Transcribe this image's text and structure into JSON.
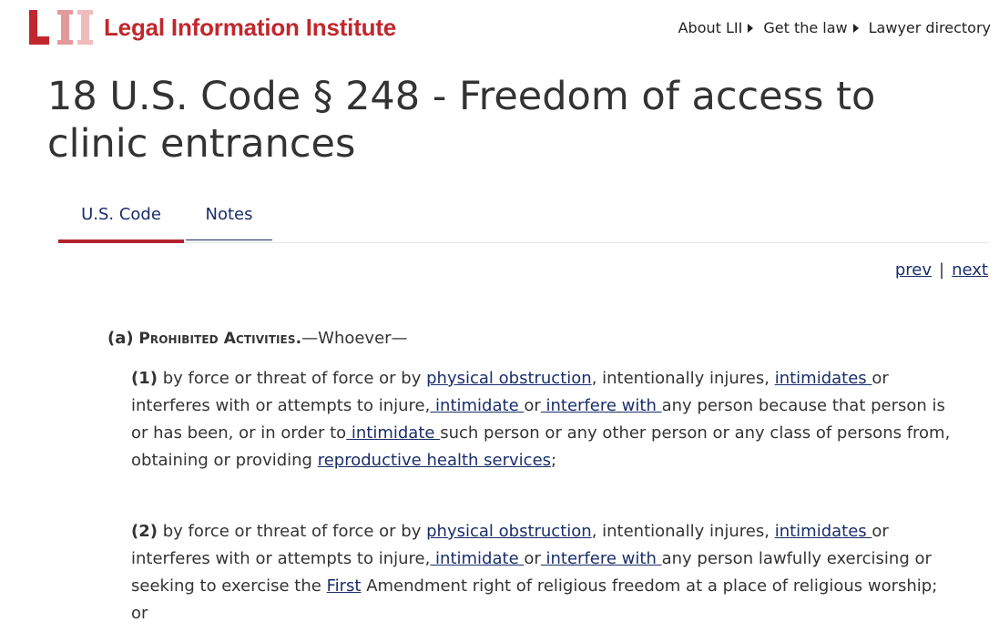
{
  "header": {
    "logo_letters": "LII",
    "logo_text": "Legal Information Institute",
    "nav": [
      {
        "label": "About LII"
      },
      {
        "label": "Get the law"
      },
      {
        "label": "Lawyer directory"
      }
    ],
    "colors": {
      "brand_red": "#c1272d",
      "link_navy": "#1a2d6b",
      "tab_active_underline": "#b0232a"
    }
  },
  "page": {
    "title": "18 U.S. Code § 248 - Freedom of access to clinic entrances"
  },
  "tabs": [
    {
      "label": "U.S. Code",
      "active": true
    },
    {
      "label": "Notes",
      "active": false
    }
  ],
  "pager": {
    "prev": "prev",
    "separator": "|",
    "next": "next"
  },
  "statute": {
    "subsection_a": {
      "enum": "(a)",
      "heading": "Prohibited Activities.",
      "lead": "—Whoever—"
    },
    "para_1": {
      "enum": "(1)",
      "t1": " by force or threat of force or by ",
      "l1": "physical obstruction",
      "t2": ", intentionally injures, ",
      "l2": "intimidates ",
      "t3": "or interferes with or attempts to injure,",
      "l3": " intimidate ",
      "t4": "or",
      "l4": " interfere with ",
      "t5": "any person because that person is or has been, or in order to",
      "l5": " intimidate ",
      "t6": "such person or any other person or any class of persons from, obtaining or providing ",
      "l6": "reproductive health services",
      "t7": ";"
    },
    "para_2": {
      "enum": "(2)",
      "t1": " by force or threat of force or by ",
      "l1": "physical obstruction",
      "t2": ", intentionally injures, ",
      "l2": "intimidates ",
      "t3": "or interferes with or attempts to injure,",
      "l3": " intimidate ",
      "t4": "or",
      "l4": " interfere with ",
      "t5": "any person lawfully exercising or seeking to exercise the ",
      "l5": "First",
      "t6": " Amendment right of religious freedom at a place of religious worship; or"
    }
  }
}
